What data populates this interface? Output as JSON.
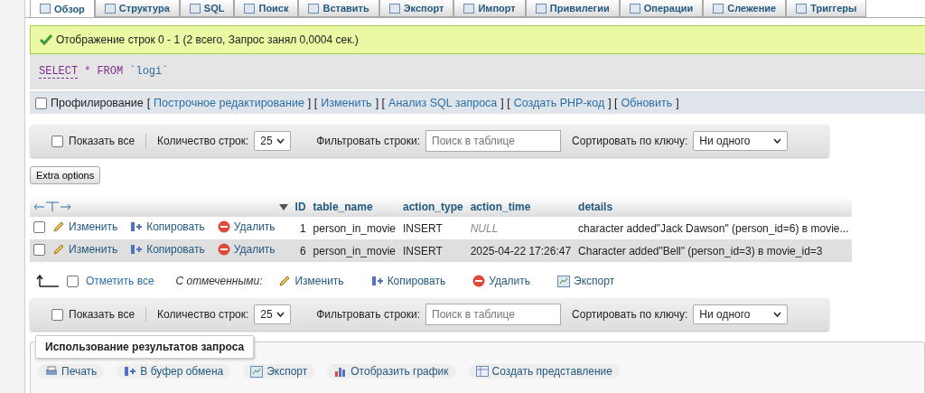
{
  "tabs": [
    {
      "label": "Обзор",
      "selected": true
    },
    {
      "label": "Структура",
      "selected": false
    },
    {
      "label": "SQL",
      "selected": false
    },
    {
      "label": "Поиск",
      "selected": false
    },
    {
      "label": "Вставить",
      "selected": false
    },
    {
      "label": "Экспорт",
      "selected": false
    },
    {
      "label": "Импорт",
      "selected": false
    },
    {
      "label": "Привилегии",
      "selected": false
    },
    {
      "label": "Операции",
      "selected": false
    },
    {
      "label": "Слежение",
      "selected": false
    },
    {
      "label": "Триггеры",
      "selected": false
    }
  ],
  "message": {
    "text": "Отображение строк 0 - 1 (2 всего, Запрос занял 0,0004 сек.)"
  },
  "query": [
    {
      "kind": "keyword",
      "text": "SELECT"
    },
    {
      "kind": "operator",
      "text": "*"
    },
    {
      "kind": "operator",
      "text": "FROM"
    },
    {
      "kind": "identifier",
      "text": "`logi`"
    }
  ],
  "profiling": {
    "label": "Профилирование",
    "checked": false,
    "items": [
      {
        "kind": "text",
        "text": "["
      },
      {
        "kind": "link",
        "text": "Построчное редактирование"
      },
      {
        "kind": "text",
        "text": "] ["
      },
      {
        "kind": "link",
        "text": "Изменить"
      },
      {
        "kind": "text",
        "text": "] ["
      },
      {
        "kind": "link",
        "text": "Анализ SQL запроса"
      },
      {
        "kind": "text",
        "text": "] ["
      },
      {
        "kind": "link",
        "text": "Создать PHP-код"
      },
      {
        "kind": "text",
        "text": "] ["
      },
      {
        "kind": "link",
        "text": "Обновить"
      },
      {
        "kind": "text",
        "text": "]"
      }
    ]
  },
  "nav_bars": [
    {
      "show_all": "Показать все",
      "show_all_checked": false,
      "rows_label": "Количество строк:",
      "rows_value": "25",
      "filter_label": "Фильтровать строки:",
      "filter_placeholder": "Поиск в таблице",
      "sort_label": "Сортировать по ключу:",
      "sort_value": "Ни одного"
    },
    {
      "show_all": "Показать все",
      "show_all_checked": false,
      "rows_label": "Количество строк:",
      "rows_value": "25",
      "filter_label": "Фильтровать строки:",
      "filter_placeholder": "Поиск в таблице",
      "sort_label": "Сортировать по ключу:",
      "sort_value": "Ни одного"
    }
  ],
  "extra_options": "Extra options",
  "table": {
    "columns": [
      "ID",
      "table_name",
      "action_type",
      "action_time",
      "details"
    ],
    "rows": [
      {
        "checked": false,
        "actions": [
          {
            "kind": "edit",
            "label": "Изменить"
          },
          {
            "kind": "copy",
            "label": "Копировать"
          },
          {
            "kind": "delete",
            "label": "Удалить"
          }
        ],
        "cells": [
          {
            "kind": "number",
            "text": "1"
          },
          {
            "kind": "text",
            "text": "person_in_movie"
          },
          {
            "kind": "text",
            "text": "INSERT"
          },
          {
            "kind": "null",
            "text": "NULL"
          },
          {
            "kind": "text",
            "text": "character added\"Jack Dawson\" (person_id=6) в movie..."
          }
        ]
      },
      {
        "checked": false,
        "actions": [
          {
            "kind": "edit",
            "label": "Изменить"
          },
          {
            "kind": "copy",
            "label": "Копировать"
          },
          {
            "kind": "delete",
            "label": "Удалить"
          }
        ],
        "cells": [
          {
            "kind": "number",
            "text": "6"
          },
          {
            "kind": "text",
            "text": "person_in_movie"
          },
          {
            "kind": "text",
            "text": "INSERT"
          },
          {
            "kind": "text",
            "text": "2025-04-22 17:26:47"
          },
          {
            "kind": "text",
            "text": "Character added\"Bell\" (person_id=3) в movie_id=3"
          }
        ]
      }
    ]
  },
  "with_selected": {
    "check_all": "Отметить все",
    "check_all_checked": false,
    "label": "С отмеченными:",
    "actions": [
      {
        "kind": "edit",
        "label": "Изменить"
      },
      {
        "kind": "copy",
        "label": "Копировать"
      },
      {
        "kind": "delete",
        "label": "Удалить"
      },
      {
        "kind": "export",
        "label": "Экспорт"
      }
    ]
  },
  "query_results": {
    "legend": "Использование результатов запроса",
    "actions": [
      {
        "kind": "print",
        "label": "Печать"
      },
      {
        "kind": "copy",
        "label": "В буфер обмена"
      },
      {
        "kind": "export",
        "label": "Экспорт"
      },
      {
        "kind": "chart",
        "label": "Отобразить график"
      },
      {
        "kind": "view",
        "label": "Создать представление"
      }
    ]
  }
}
